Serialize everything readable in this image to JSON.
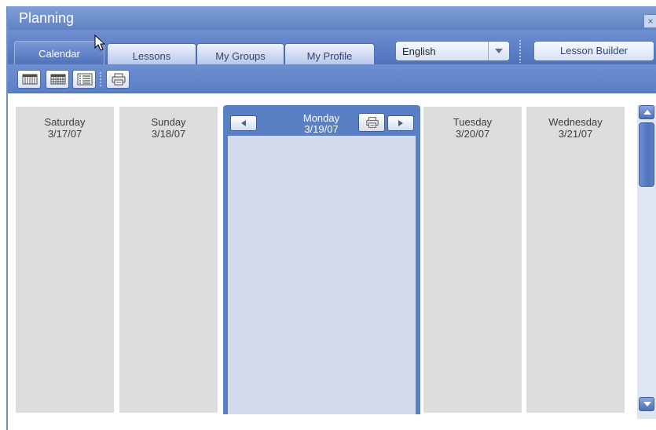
{
  "window": {
    "title": "Planning",
    "close_label": "×"
  },
  "tabs": [
    {
      "label": "Calendar",
      "active": true
    },
    {
      "label": "Lessons",
      "active": false
    },
    {
      "label": "My Groups",
      "active": false
    },
    {
      "label": "My Profile",
      "active": false
    }
  ],
  "language_select": {
    "value": "English"
  },
  "lesson_builder_label": "Lesson Builder",
  "toolbar": {
    "icons": [
      "week-view-icon",
      "month-view-icon",
      "list-view-icon",
      "print-icon"
    ]
  },
  "days": [
    {
      "name": "Saturday",
      "date": "3/17/07"
    },
    {
      "name": "Sunday",
      "date": "3/18/07"
    },
    {
      "name": "Monday",
      "date": "3/19/07",
      "selected": true
    },
    {
      "name": "Tuesday",
      "date": "3/20/07"
    },
    {
      "name": "Wednesday",
      "date": "3/21/07"
    }
  ],
  "colors": {
    "titlebar": "#6f8fd0",
    "selected_day": "#5a7fc2",
    "selected_day_body": "#d3dcee",
    "day_column": "#dddddd"
  }
}
